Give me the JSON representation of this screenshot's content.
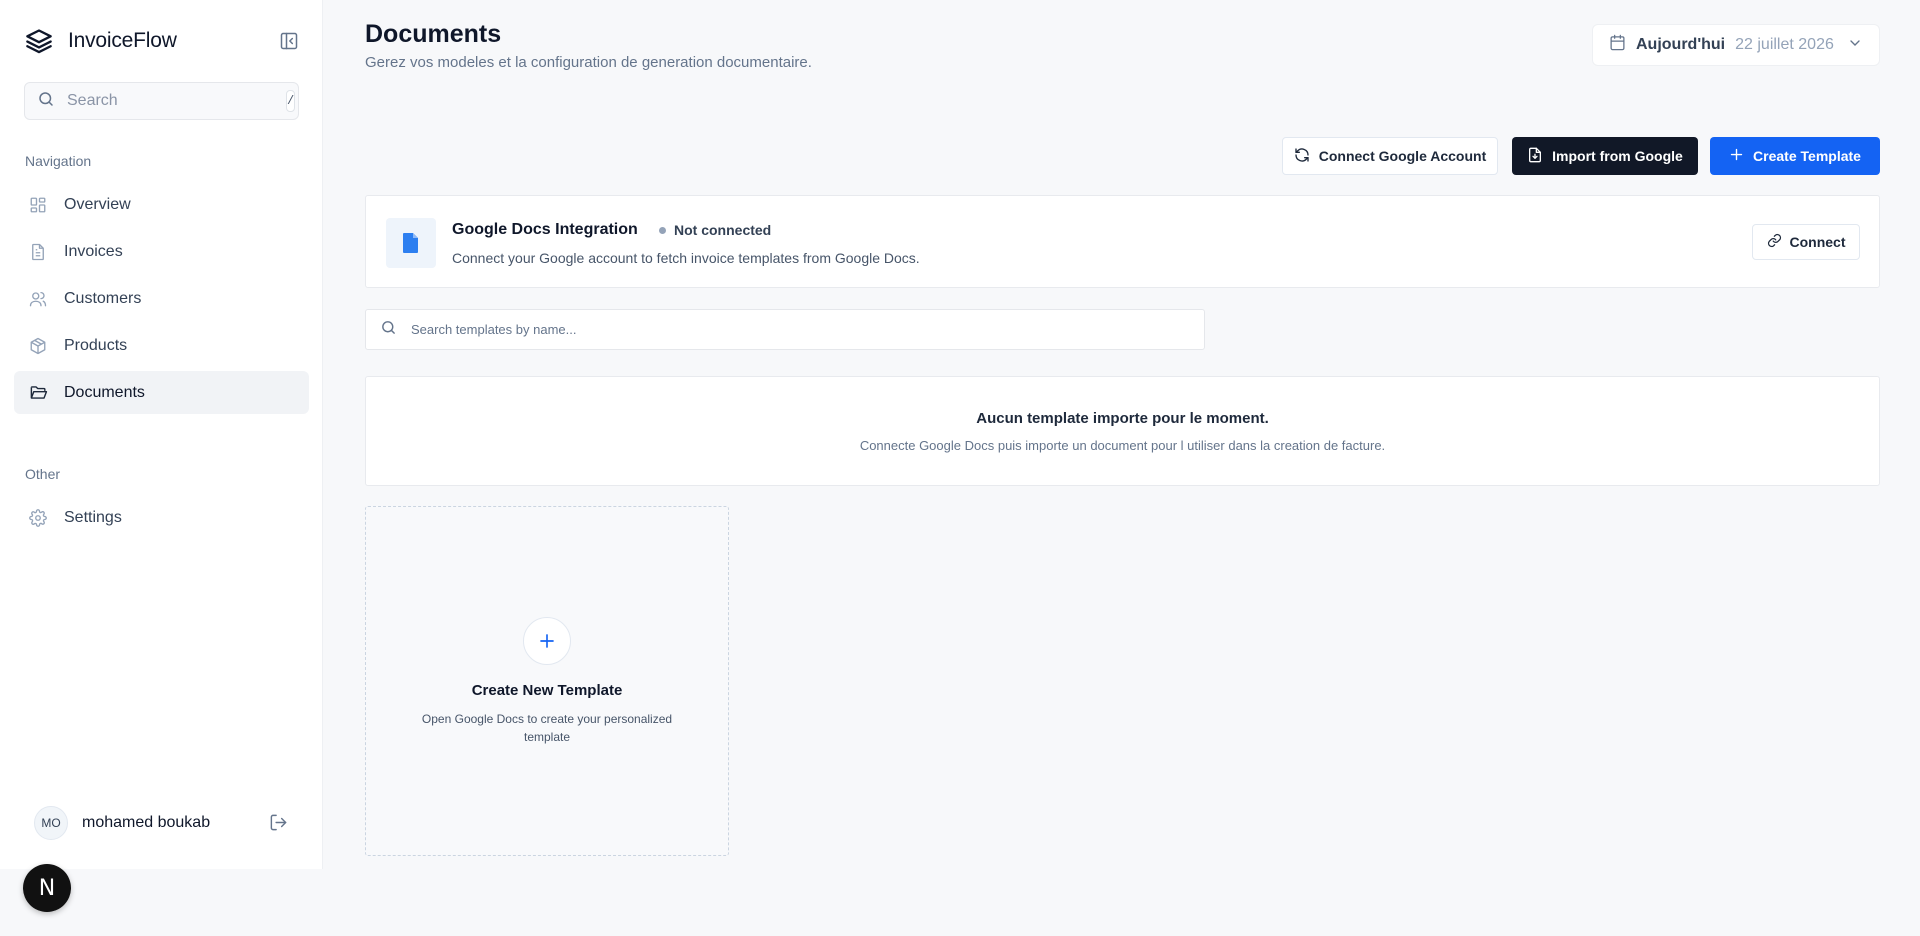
{
  "app": {
    "name": "InvoiceFlow"
  },
  "sidebar": {
    "search_placeholder": "Search",
    "search_shortcut": "/",
    "nav_section_label": "Navigation",
    "nav_items": [
      {
        "label": "Overview",
        "icon": "grid-icon"
      },
      {
        "label": "Invoices",
        "icon": "file-text-icon"
      },
      {
        "label": "Customers",
        "icon": "users-icon"
      },
      {
        "label": "Products",
        "icon": "package-icon"
      },
      {
        "label": "Documents",
        "icon": "folder-open-icon",
        "active": true
      }
    ],
    "other_section_label": "Other",
    "other_items": [
      {
        "label": "Settings",
        "icon": "gear-icon"
      }
    ],
    "user": {
      "initials": "MO",
      "name": "mohamed boukab"
    },
    "next_badge": "N"
  },
  "header": {
    "title": "Documents",
    "subtitle": "Gerez vos modeles et la configuration de generation documentaire.",
    "date_label": "Aujourd'hui",
    "date_value": "22 juillet 2026"
  },
  "actions": {
    "connect_account": "Connect Google Account",
    "import": "Import from Google",
    "create": "Create Template"
  },
  "integration": {
    "title": "Google Docs Integration",
    "status": "Not connected",
    "description": "Connect your Google account to fetch invoice templates from Google Docs.",
    "connect_label": "Connect"
  },
  "template_search": {
    "placeholder": "Search templates by name..."
  },
  "empty_state": {
    "title": "Aucun template importe pour le moment.",
    "description": "Connecte Google Docs puis importe un document pour l utiliser dans la creation de facture."
  },
  "new_template_card": {
    "title": "Create New Template",
    "description": "Open Google Docs to create your personalized template"
  },
  "colors": {
    "primary": "#1463f3",
    "dark_button": "#111827",
    "background": "#f7f8fa",
    "status_dot": "#94a3b8",
    "doc_icon": "#2d7ff0"
  }
}
